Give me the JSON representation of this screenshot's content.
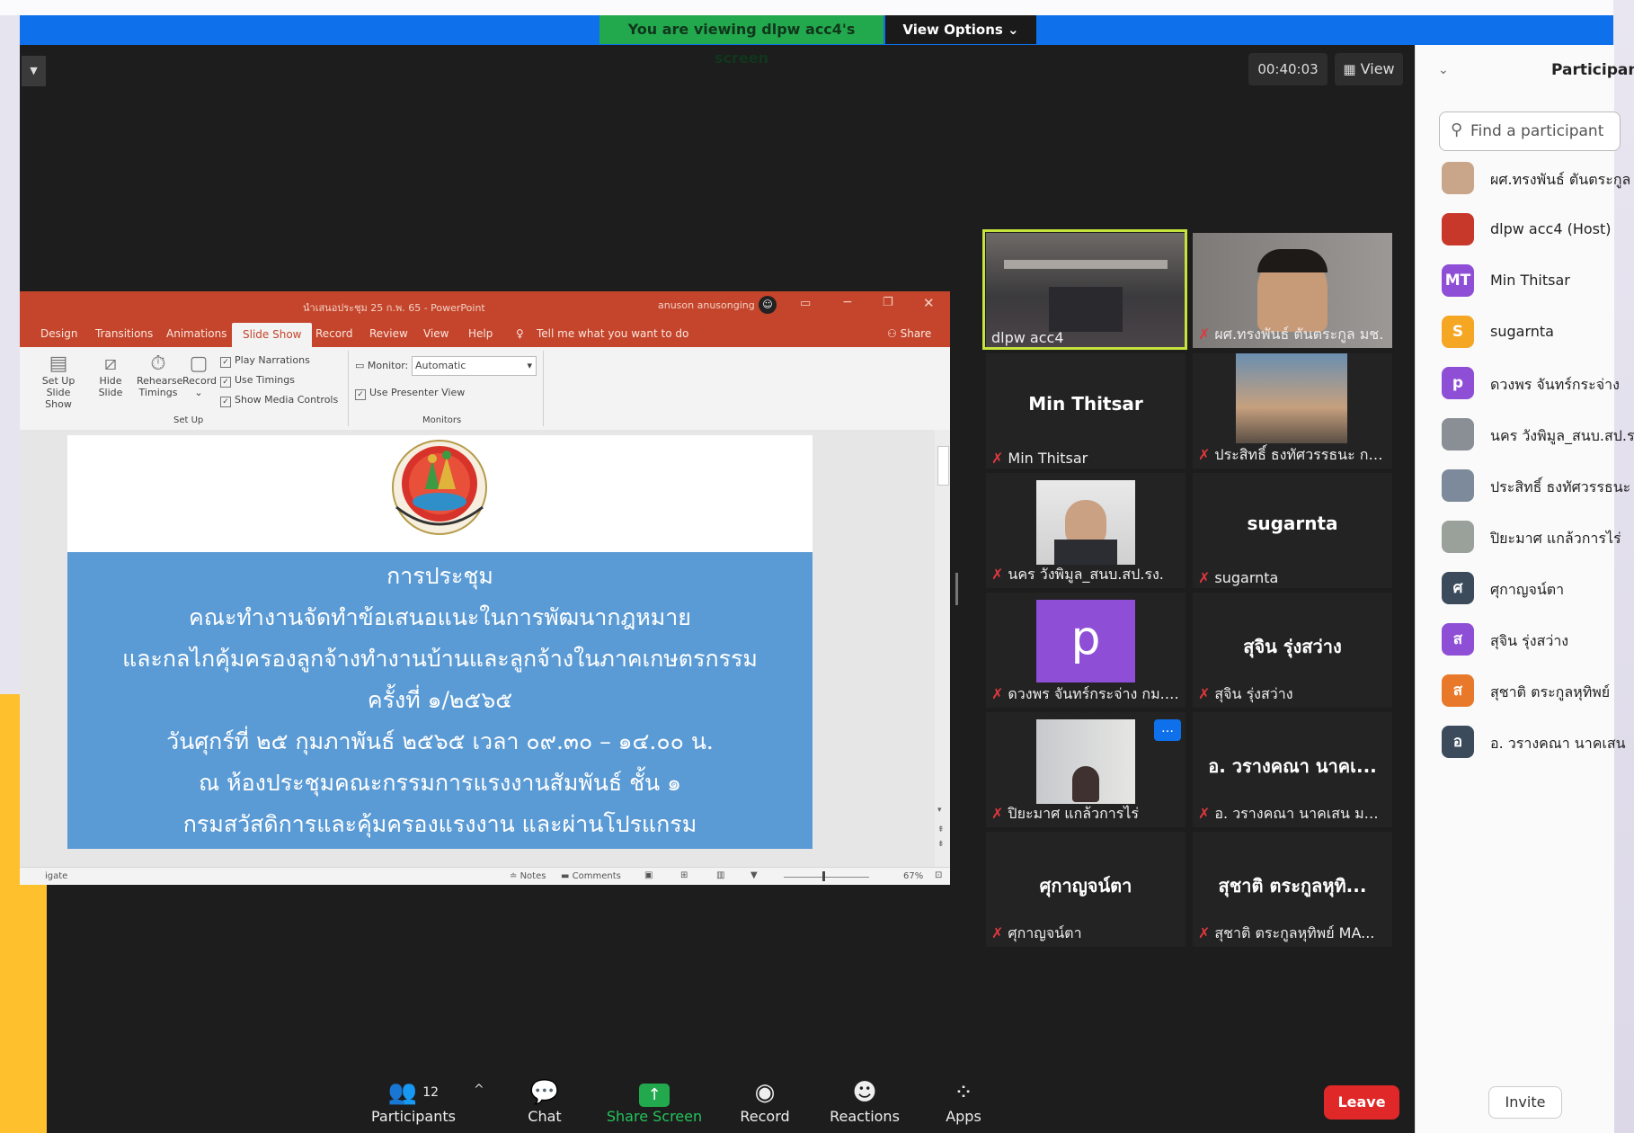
{
  "share_banner": {
    "viewing": "You are viewing dlpw acc4's screen",
    "view_options": "View Options"
  },
  "meeting": {
    "timer": "00:40:03",
    "view": "View"
  },
  "ppt": {
    "title": "นำเสนอประชุม 25 ก.พ. 65 - PowerPoint",
    "user": "anuson anusonging",
    "tabs": [
      "Design",
      "Transitions",
      "Animations",
      "Slide Show",
      "Record",
      "Review",
      "View",
      "Help"
    ],
    "tell_me": "Tell me what you want to do",
    "share": "Share",
    "ribbon": {
      "setup": "Set Up",
      "slide_show": "Slide Show",
      "hide": "Hide",
      "slide": "Slide",
      "rehearse": "Rehearse",
      "timings": "Timings",
      "record": "Record",
      "play_narrations": "Play Narrations",
      "use_timings": "Use Timings",
      "show_media_controls": "Show Media Controls",
      "setup_group": "Set Up",
      "monitor_label": "Monitor:",
      "monitor_value": "Automatic",
      "use_presenter_view": "Use Presenter View",
      "monitors_group": "Monitors"
    },
    "slide": {
      "lines": [
        "การประชุม",
        "คณะทำงานจัดทำข้อเสนอแนะในการพัฒนากฎหมาย",
        "และกลไกคุ้มครองลูกจ้างทำงานบ้านและลูกจ้างในภาคเกษตรกรรม",
        "ครั้งที่ ๑/๒๕๖๕",
        "วันศุกร์ที่ ๒๕ กุมภาพันธ์ ๒๕๖๕ เวลา ๐๙.๓๐ – ๑๔.๐๐ น.",
        "ณ ห้องประชุมคณะกรรมการแรงงานสัมพันธ์ ชั้น ๑",
        "กรมสวัสดิการและคุ้มครองแรงงาน และผ่านโปรแกรม"
      ],
      "seal_text": "กรมสวัสดิการและคุ้มครองแรงงาน"
    },
    "status": {
      "left": "igate",
      "notes": "Notes",
      "comments": "Comments",
      "zoom": "67%"
    }
  },
  "tiles": [
    {
      "name": "dlpw acc4",
      "center": "",
      "muted": false
    },
    {
      "name": "ผศ.ทรงพันธ์ ตันตระกูล มช.",
      "center": "",
      "muted": true
    },
    {
      "name": "Min Thitsar",
      "center": "Min Thitsar",
      "muted": true
    },
    {
      "name": "ประสิทธิ์ ธงทัศวรรธนะ กก...",
      "center": "",
      "muted": true
    },
    {
      "name": "นคร วังพิมูล_สนบ.สป.รง.",
      "center": "",
      "muted": true
    },
    {
      "name": "sugarnta",
      "center": "sugarnta",
      "muted": true
    },
    {
      "name": "ดวงพร จันทร์กระจ่าง กม. ...",
      "center": "",
      "muted": true,
      "letter": "p"
    },
    {
      "name": "สุจิน รุ่งสว่าง",
      "center": "สุจิน รุ่งสว่าง",
      "muted": true
    },
    {
      "name": "ปิยะมาศ แกล้วการไร่",
      "center": "",
      "muted": true
    },
    {
      "name": "อ. วรางคณา นาคเสน มห...",
      "center": "อ. วรางคณา นาคเ...",
      "muted": true
    },
    {
      "name": "ศุกาญจน์ตา",
      "center": "ศุกาญจน์ตา",
      "muted": true
    },
    {
      "name": "สุชาติ ตระกูลหุทิพย์ MA...",
      "center": "สุชาติ ตระกูลหุทิ...",
      "muted": true
    }
  ],
  "panel": {
    "title": "Participants",
    "search_placeholder": "Find a participant",
    "participants": [
      {
        "name": "ผศ.ทรงพันธ์ ตันตระกูล",
        "initial": "",
        "color": "#c9a68a"
      },
      {
        "name": "dlpw acc4 (Host)",
        "initial": "",
        "color": "#c7382a"
      },
      {
        "name": "Min Thitsar",
        "initial": "MT",
        "color": "#8e4fd6"
      },
      {
        "name": "sugarnta",
        "initial": "S",
        "color": "#f5a623"
      },
      {
        "name": "ดวงพร จันทร์กระจ่าง",
        "initial": "p",
        "color": "#8e4fd6"
      },
      {
        "name": "นคร วังพิมูล_สนบ.สป.รง.",
        "initial": "",
        "color": "#8a8f96"
      },
      {
        "name": "ประสิทธิ์ ธงทัศวรรธนะ",
        "initial": "",
        "color": "#7c8a9b"
      },
      {
        "name": "ปิยะมาศ แกล้วการไร่",
        "initial": "",
        "color": "#9aa19a"
      },
      {
        "name": "ศุกาญจน์ตา",
        "initial": "ศ",
        "color": "#3c4b5c"
      },
      {
        "name": "สุจิน รุ่งสว่าง",
        "initial": "ส",
        "color": "#8e4fd6"
      },
      {
        "name": "สุชาติ ตระกูลหุทิพย์",
        "initial": "ส",
        "color": "#e8792b"
      },
      {
        "name": "อ. วรางคณา นาคเสน",
        "initial": "อ",
        "color": "#3c4b5c"
      }
    ],
    "invite": "Invite"
  },
  "toolbar": {
    "participants_label": "Participants",
    "participants_count": "12",
    "chat": "Chat",
    "share_screen": "Share Screen",
    "record": "Record",
    "reactions": "Reactions",
    "apps": "Apps",
    "leave": "Leave"
  },
  "colors": {
    "zoom_bg": "#1d1d1d",
    "share_green": "#23a94d",
    "leave_red": "#e02828",
    "slide_blue": "#5b9bd5",
    "ppt_orange": "#c4452b",
    "active_speaker": "#c6e33d"
  }
}
